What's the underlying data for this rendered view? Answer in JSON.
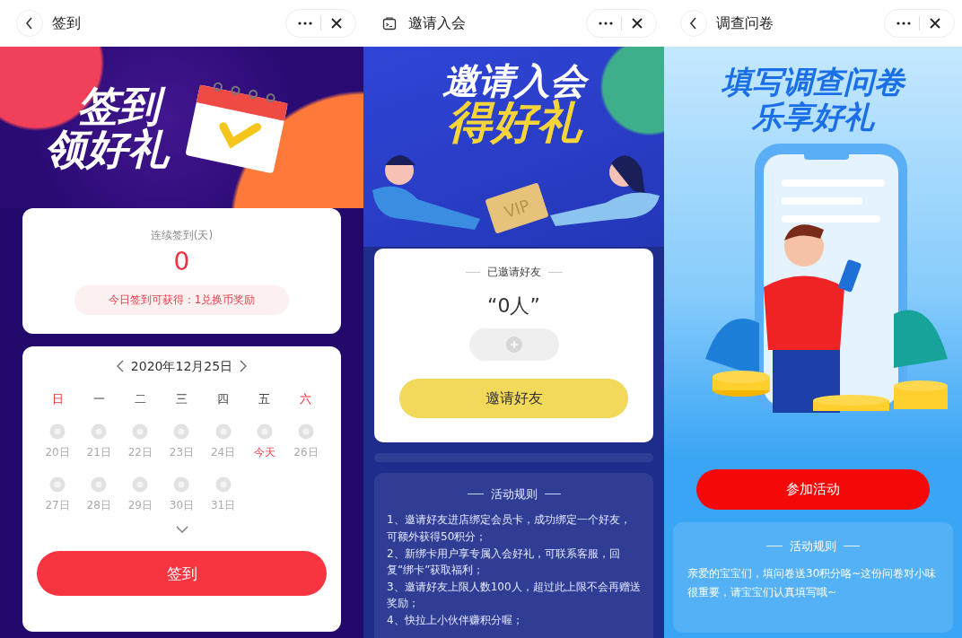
{
  "panels": [
    {
      "kind": "signin",
      "header": {
        "kind": "back",
        "title": "签到"
      },
      "banner": {
        "lines": [
          "签到",
          "领好礼"
        ]
      },
      "streak": {
        "label": "连续签到(天)",
        "value": "0",
        "reward": "今日签到可获得：1兑换币奖励"
      },
      "calendar": {
        "date": "2020年12月25日",
        "weekdays": [
          {
            "label": "日",
            "weekend": true
          },
          {
            "label": "一",
            "weekend": false
          },
          {
            "label": "二",
            "weekend": false
          },
          {
            "label": "三",
            "weekend": false
          },
          {
            "label": "四",
            "weekend": false
          },
          {
            "label": "五",
            "weekend": false
          },
          {
            "label": "六",
            "weekend": true
          }
        ],
        "days": [
          {
            "label": "20日",
            "today": false,
            "checked": false
          },
          {
            "label": "21日",
            "today": false,
            "checked": false
          },
          {
            "label": "22日",
            "today": false,
            "checked": false
          },
          {
            "label": "23日",
            "today": false,
            "checked": false
          },
          {
            "label": "24日",
            "today": false,
            "checked": false
          },
          {
            "label": "今天",
            "today": true,
            "checked": false
          },
          {
            "label": "26日",
            "today": false,
            "checked": false
          },
          {
            "label": "27日",
            "today": false,
            "checked": false
          },
          {
            "label": "28日",
            "today": false,
            "checked": false
          },
          {
            "label": "29日",
            "today": false,
            "checked": false
          },
          {
            "label": "30日",
            "today": false,
            "checked": false
          },
          {
            "label": "31日",
            "today": false,
            "checked": false
          }
        ]
      },
      "button": "签到"
    },
    {
      "kind": "invite",
      "header": {
        "kind": "app",
        "title": "邀请入会"
      },
      "banner": {
        "lines": [
          "邀请入会",
          "得好礼"
        ],
        "card_text": "VIP"
      },
      "invited": {
        "label": "已邀请好友",
        "count": "“0人”"
      },
      "button": "邀请好友",
      "rules": {
        "title": "活动规则",
        "items": [
          "1、邀请好友进店绑定会员卡，成功绑定一个好友，可额外获得50积分；",
          "2、新绑卡用户享专属入会好礼，可联系客服，回复“绑卡”获取福利；",
          "3、邀请好友上限人数100人，超过此上限不会再赠送奖励；",
          "4、快拉上小伙伴赚积分喔；"
        ]
      }
    },
    {
      "kind": "survey",
      "header": {
        "kind": "back",
        "title": "调查问卷"
      },
      "banner": {
        "lines": [
          "填写调查问卷",
          "乐享好礼"
        ]
      },
      "button": "参加活动",
      "rules": {
        "title": "活动规则",
        "text": "亲爱的宝宝们，填问卷送30积分咯~这份问卷对小味很重要，请宝宝们认真填写哦~"
      }
    }
  ]
}
